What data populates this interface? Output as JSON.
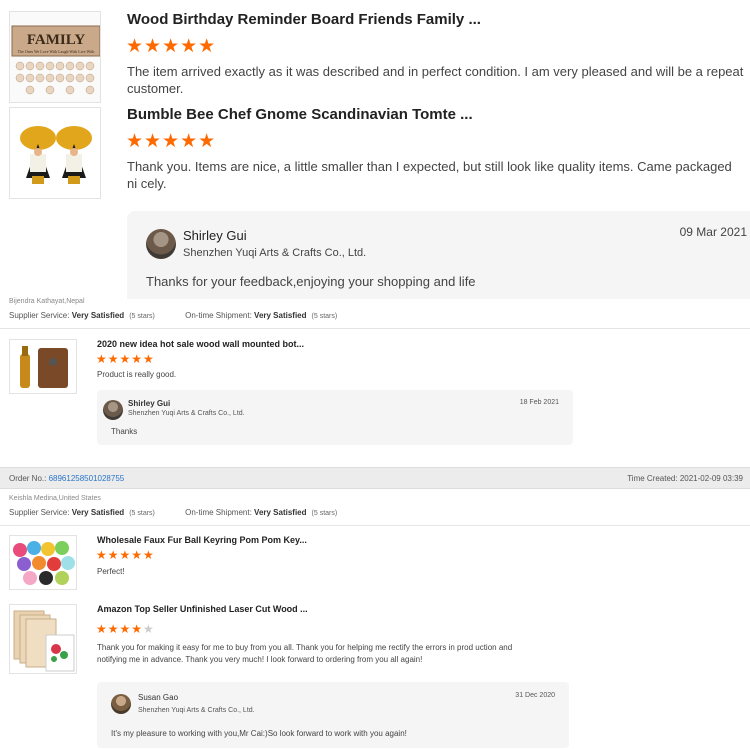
{
  "top": {
    "product1": {
      "title": "Wood Birthday Reminder Board Friends Family ...",
      "stars": "★★★★★",
      "review": "The item arrived exactly as it was described and in perfect condition. I am very pleased and will be a repeat customer."
    },
    "product2": {
      "title": "Bumble Bee Chef Gnome Scandinavian Tomte ...",
      "stars": "★★★★★",
      "review": "Thank you. Items are nice, a little smaller than I expected, but still look like quality items. Came packaged ni cely."
    },
    "reply": {
      "name": "Shirley Gui",
      "company": "Shenzhen Yuqi Arts & Crafts Co., Ltd.",
      "date": "09 Mar 2021",
      "text": "Thanks for your feedback,enjoying your shopping and life"
    },
    "family_sign": {
      "word": "FAMILY",
      "tagline": "The Ones We Love With Laugh With Live With"
    }
  },
  "order1": {
    "buyer": "Bijendra Kathayat,Nepal",
    "supplier_label": "Supplier Service:",
    "supplier_value": "Very Satisfied",
    "supplier_sub": "(5 stars)",
    "shipment_label": "On-time Shipment:",
    "shipment_value": "Very Satisfied",
    "shipment_sub": "(5 stars)",
    "product": {
      "title": "2020 new idea hot sale wood wall mounted bot...",
      "stars": "★★★★★",
      "review": "Product is really good."
    },
    "reply": {
      "name": "Shirley Gui",
      "company": "Shenzhen Yuqi Arts & Crafts Co., Ltd.",
      "date": "18 Feb 2021",
      "text": "Thanks"
    }
  },
  "order2": {
    "order_label": "Order No.:",
    "order_no": "68961258501028755",
    "created_label": "Time Created:",
    "created_value": "2021-02-09 03:39",
    "buyer": "Keishla Medina,United States",
    "supplier_label": "Supplier Service:",
    "supplier_value": "Very Satisfied",
    "supplier_sub": "(5 stars)",
    "shipment_label": "On-time Shipment:",
    "shipment_value": "Very Satisfied",
    "shipment_sub": "(5 stars)",
    "product1": {
      "title": "Wholesale Faux Fur Ball Keyring Pom Pom Key...",
      "stars": "★★★★★",
      "review": "Perfect!"
    },
    "product2": {
      "title": "Amazon Top Seller Unfinished Laser Cut Wood ...",
      "stars_filled": "★★★★",
      "stars_empty": "★",
      "rating": 4,
      "review": "Thank you for making it easy for me to buy from you all. Thank you for helping me rectify the errors in prod uction and notifying me in advance. Thank you very much! I look forward to ordering from you all again!"
    },
    "reply": {
      "name": "Susan Gao",
      "company": "Shenzhen Yuqi Arts & Crafts Co., Ltd.",
      "date": "31 Dec 2020",
      "text": "It's my pleasure to working with you,Mr Cai:)So look forward to work with you again!"
    }
  },
  "colors": {
    "star": "#ff6a00",
    "link": "#2a75c8",
    "reply_bg": "#f5f5f5"
  }
}
